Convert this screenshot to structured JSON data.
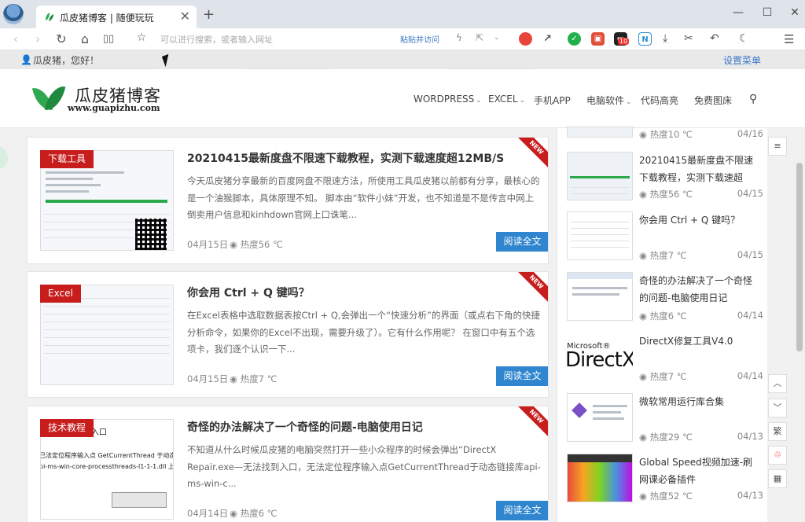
{
  "browser": {
    "tab_title": "瓜皮猪博客 | 随便玩玩",
    "tab_close": "✕",
    "new_tab": "+",
    "address_placeholder": "可以进行搜索，或者输入网址",
    "paste_go": "粘贴并访问",
    "ext_badge": "10",
    "window_controls": [
      "—",
      "☐",
      "✕"
    ]
  },
  "site": {
    "greeting": "瓜皮猪，您好！",
    "settings_menu": "设置菜单",
    "logo_cn": "瓜皮猪博客",
    "logo_en": "www.guapizhu.com",
    "nav": [
      {
        "label": "WORDPRESS",
        "caret": "⌄"
      },
      {
        "label": "EXCEL",
        "caret": "⌄"
      },
      {
        "label": "手机APP",
        "caret": ""
      },
      {
        "label": "电脑软件",
        "caret": "⌄"
      },
      {
        "label": "代码高亮",
        "caret": ""
      },
      {
        "label": "免费图床",
        "caret": ""
      }
    ]
  },
  "posts": [
    {
      "category": "下载工具",
      "new_tag": "NEW",
      "title": "20210415最新度盘不限速下载教程，实测下载速度超12MB/S",
      "excerpt": "今天瓜皮猪分享最新的百度网盘不限速方法，所使用工具瓜皮猪以前都有分享，最核心的是一个油猴脚本，具体原理不知。 脚本由“软件小妹”开发，也不知道是不是传言中网上倒卖用户信息和kinhdown官网上口诛笔...",
      "date": "04月15日",
      "heat": "热度56 ℃",
      "read": "阅读全文"
    },
    {
      "category": "Excel",
      "new_tag": "NEW",
      "title": "你会用 Ctrl + Q 键吗？",
      "excerpt": "在Excel表格中选取数据表按Ctrl + Q,会弹出一个“快速分析”的界面（或点右下角的快捷分析命令，如果你的Excel不出现，需要升级了）。它有什么作用呢？ 在窗口中有五个选项卡，我们逐个认识一下...",
      "date": "04月15日",
      "heat": "热度7 ℃",
      "read": "阅读全文"
    },
    {
      "category": "技术教程",
      "new_tag": "NEW",
      "title": "奇怪的办法解决了一个奇怪的问题-电脑使用日记",
      "excerpt": "不知道从什么时候瓜皮猪的电脑突然打开一些小众程序的时候会弹出“DirectX Repair.exe—无法找到入口，无法定位程序输入点GetCurrentThread于动态链接库api-ms-win-c...",
      "date": "04月14日",
      "heat": "热度6 ℃",
      "read": "阅读全文"
    }
  ],
  "thumb_text": {
    "post3_a": "入口",
    "post3_b": "已法定位程序输入点 GetCurrentThread 于动态",
    "post3_c": "pi-ms-win-core-processthreads-l1-1-1.dll 上"
  },
  "sidebar": {
    "top_heat": "热度10 ℃",
    "top_date": "04/16",
    "items": [
      {
        "title": "20210415最新度盘不限速下载教程，实测下载速超",
        "heat": "热度56 ℃",
        "date": "04/15"
      },
      {
        "title": "你会用 Ctrl + Q 键吗？",
        "heat": "热度7 ℃",
        "date": "04/15"
      },
      {
        "title": "奇怪的办法解决了一个奇怪的问题-电脑使用日记",
        "heat": "热度6 ℃",
        "date": "04/14"
      },
      {
        "title": "DirectX修复工具V4.0",
        "heat": "热度7 ℃",
        "date": "04/14"
      },
      {
        "title": "微软常用运行库合集",
        "heat": "热度29 ℃",
        "date": "04/13"
      },
      {
        "title": "Global Speed视频加速-刷网课必备插件",
        "heat": "热度52 ℃",
        "date": "04/13"
      }
    ],
    "directx_logo_small": "Microsoft®",
    "directx_logo_big": "DirectX"
  },
  "right_tools": [
    "≡",
    "︿",
    "﹀",
    "繁",
    "♲",
    "▦"
  ],
  "colors": {
    "accent": "#2f86cf",
    "category_red": "#c81d1d",
    "logo_green": "#2fa84f"
  },
  "icons": [
    "back-icon",
    "forward-icon",
    "refresh-icon",
    "home-icon",
    "reader-icon",
    "star-icon",
    "search-icon",
    "eye-icon"
  ]
}
